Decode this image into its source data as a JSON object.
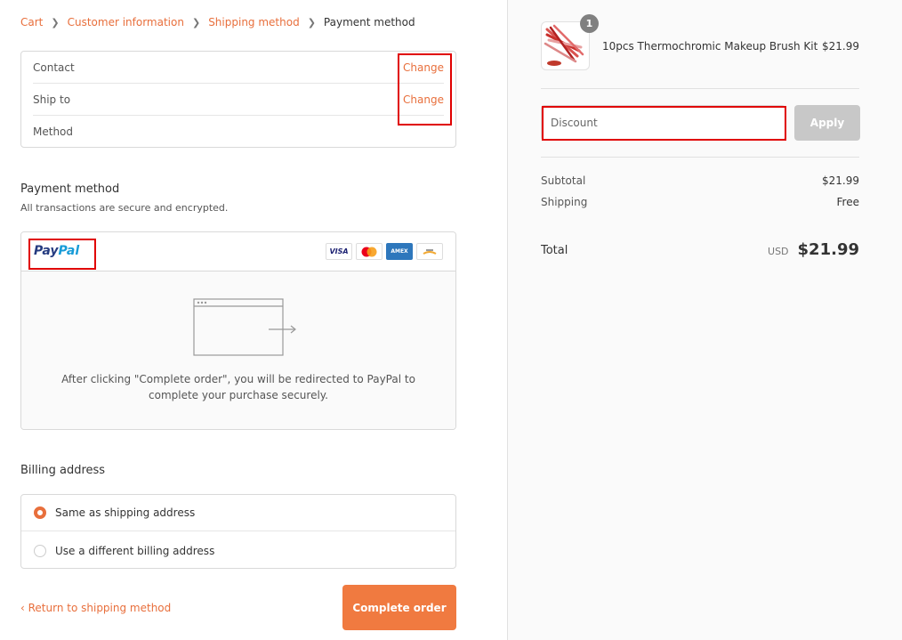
{
  "breadcrumb": {
    "items": [
      "Cart",
      "Customer information",
      "Shipping method"
    ],
    "current": "Payment method"
  },
  "review": {
    "contact_label": "Contact",
    "ship_to_label": "Ship to",
    "method_label": "Method",
    "change_label": "Change"
  },
  "payment": {
    "title": "Payment method",
    "subtitle": "All transactions are secure and encrypted.",
    "paypal_logo_part1": "Pay",
    "paypal_logo_part2": "Pal",
    "card_visa": "VISA",
    "card_amex": "AMEX",
    "redirect_line1": "After clicking \"Complete order\", you will be redirected to PayPal to",
    "redirect_line2": "complete your purchase securely."
  },
  "billing": {
    "title": "Billing address",
    "option_same": "Same as shipping address",
    "option_different": "Use a different billing address",
    "selected": "same"
  },
  "footer": {
    "return_link": "Return to shipping method",
    "complete_button": "Complete order"
  },
  "summary": {
    "product_name": "10pcs Thermochromic Makeup Brush Kit",
    "product_price": "$21.99",
    "quantity": "1",
    "discount_placeholder": "Discount",
    "apply_button": "Apply",
    "subtotal_label": "Subtotal",
    "subtotal_value": "$21.99",
    "shipping_label": "Shipping",
    "shipping_value": "Free",
    "total_label": "Total",
    "total_currency": "USD",
    "total_value": "$21.99"
  },
  "colors": {
    "accent": "#e86f3c",
    "button": "#f07a40",
    "highlight_box": "#e00000"
  }
}
